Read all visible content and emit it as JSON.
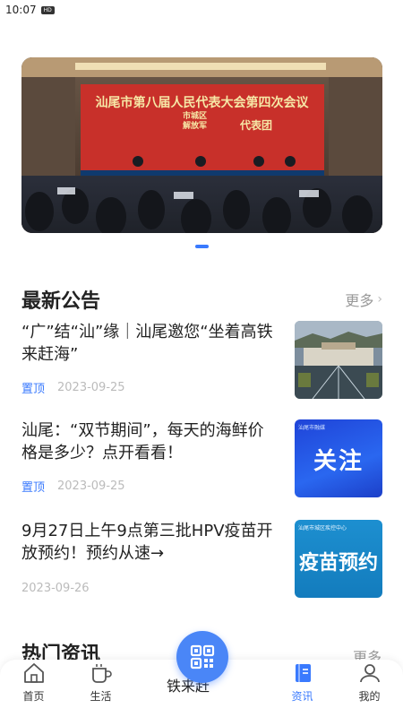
{
  "status_bar": {
    "time": "10:07",
    "badge": "HD"
  },
  "banner": {
    "title": "汕尾市第八届人民代表大会第四次会议",
    "sub_left_1": "市城区",
    "sub_left_2": "解放军",
    "sub_right": "代表团"
  },
  "notices": {
    "title": "最新公告",
    "more": "更多",
    "items": [
      {
        "title": "“广”结“汕”缘｜汕尾邀您“坐着高铁来赶海”",
        "pin": "置顶",
        "date": "2023-09-25",
        "thumb": "high-speed-rail-city"
      },
      {
        "title": "汕尾：“双节期间”，每天的海鲜价格是多少？点开看看！",
        "pin": "置顶",
        "date": "2023-09-25",
        "thumb_text": "关注",
        "thumb_corner": "汕尾市融媒"
      },
      {
        "title": "9月27日上午9点第三批HPV疫苗开放预约！预约从速→",
        "date": "2023-09-26",
        "thumb_text": "疫苗预约",
        "thumb_corner": "汕尾市城区疾控中心"
      }
    ]
  },
  "hot": {
    "title": "热门资讯",
    "more": "更多",
    "peek_text": "铁来赶"
  },
  "bottom_nav": {
    "items": [
      {
        "label": "首页",
        "icon": "home-icon"
      },
      {
        "label": "生活",
        "icon": "cup-icon"
      },
      {
        "label": "资讯",
        "icon": "book-icon"
      },
      {
        "label": "我的",
        "icon": "user-icon"
      }
    ],
    "center_icon": "qr-code-icon"
  },
  "colors": {
    "accent": "#3a7afe",
    "banner_red": "#c8302a",
    "muted": "#bbbbbb"
  }
}
